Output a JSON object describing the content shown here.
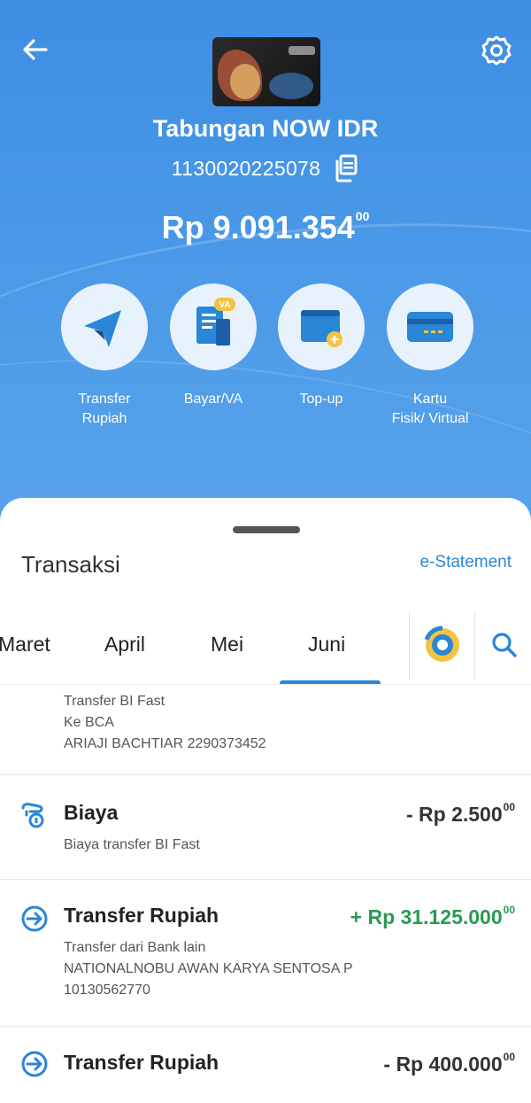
{
  "header": {
    "account_name": "Tabungan NOW IDR",
    "account_number": "1130020225078",
    "balance_main": "Rp 9.091.354",
    "balance_cents": "00"
  },
  "icons": {
    "back": "arrow-left-icon",
    "settings": "gear-icon",
    "copy": "copy-icon"
  },
  "actions": [
    {
      "label": "Transfer Rupiah",
      "icon": "paper-plane-icon"
    },
    {
      "label": "Bayar/VA",
      "icon": "bill-va-icon"
    },
    {
      "label": "Top-up",
      "icon": "wallet-plus-icon"
    },
    {
      "label": "Kartu Fisik/ Virtual",
      "icon": "card-icon"
    }
  ],
  "transactions_section": {
    "title": "Transaksi",
    "estatement_label": "e-Statement",
    "months": [
      "Maret",
      "April",
      "Mei",
      "Juni"
    ],
    "selected_month": "Juni"
  },
  "transactions": {
    "partial": {
      "lines": [
        "Transfer BI Fast",
        "Ke BCA",
        "ARIAJI BACHTIAR 2290373452"
      ]
    },
    "items": [
      {
        "title": "Biaya",
        "sign": "- ",
        "amount": "Rp 2.500",
        "cents": "00",
        "direction": "out",
        "desc_lines": [
          "Biaya transfer BI Fast"
        ],
        "icon": "fee-coin-icon"
      },
      {
        "title": "Transfer Rupiah",
        "sign": "+ ",
        "amount": "Rp 31.125.000",
        "cents": "00",
        "direction": "in",
        "desc_lines": [
          "Transfer dari Bank lain",
          "NATIONALNOBU AWAN KARYA SENTOSA P",
          "10130562770"
        ],
        "icon": "transfer-in-icon"
      },
      {
        "title": "Transfer Rupiah",
        "sign": "- ",
        "amount": "Rp 400.000",
        "cents": "00",
        "direction": "out",
        "desc_lines": [],
        "icon": "transfer-out-icon"
      }
    ]
  },
  "colors": {
    "brand_blue": "#4c99e6",
    "accent_blue": "#2a86d6",
    "income_green": "#2a9a52",
    "badge_yellow": "#f5c242"
  }
}
